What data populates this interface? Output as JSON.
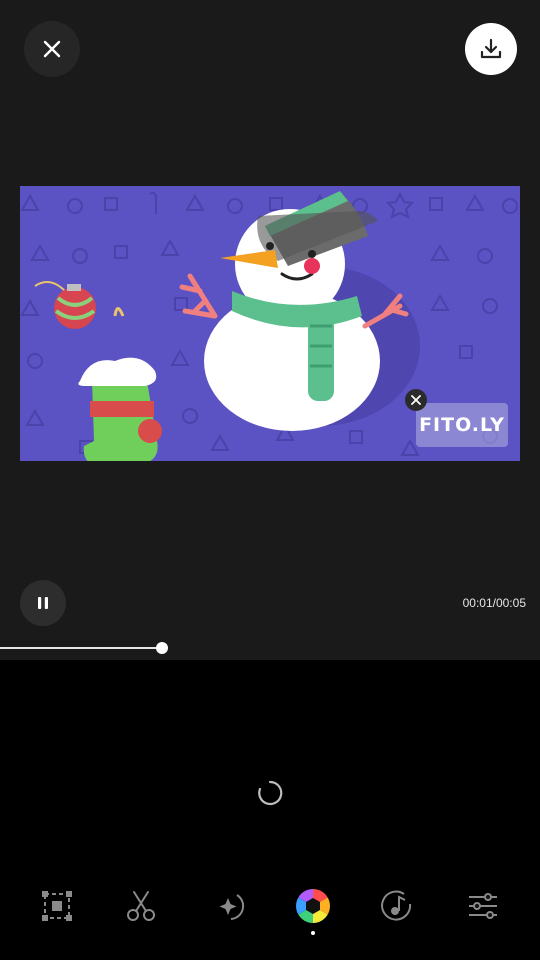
{
  "player": {
    "time_display": "00:01/00:05",
    "progress": 0.3
  },
  "video": {
    "watermark_text": "FITO.LY",
    "background_color": "#5b52c4"
  },
  "toolbar": {
    "tools": [
      {
        "name": "crop-tool",
        "icon": "crop-icon"
      },
      {
        "name": "trim-tool",
        "icon": "scissors-icon"
      },
      {
        "name": "effects-tool",
        "icon": "sparkle-icon"
      },
      {
        "name": "filter-tool",
        "icon": "color-wheel-icon",
        "active": true
      },
      {
        "name": "music-tool",
        "icon": "music-icon"
      },
      {
        "name": "adjust-tool",
        "icon": "sliders-icon"
      }
    ]
  },
  "colors": {
    "accent": "#ffffff",
    "surface": "#1a1a1a"
  }
}
